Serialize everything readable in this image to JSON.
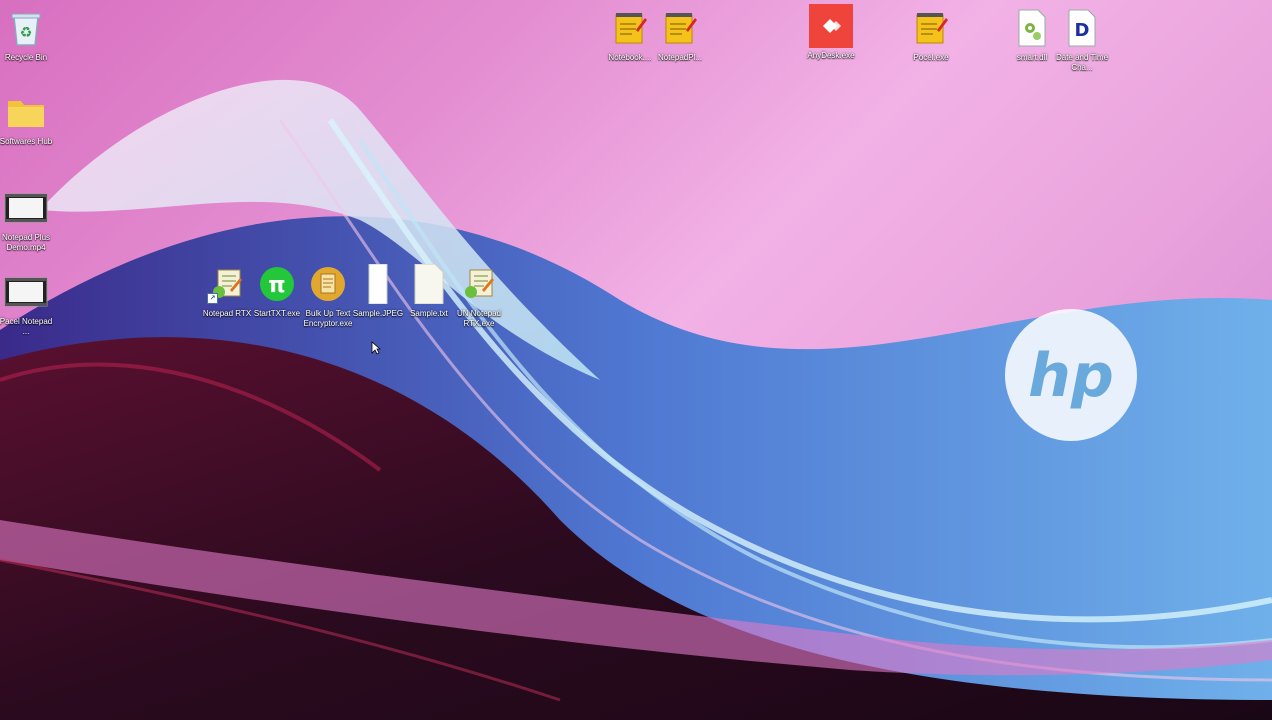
{
  "desktop": {
    "brand_logo": "hp",
    "icons_left": [
      {
        "label": "Recycle Bin",
        "icon": "recycle-bin-icon"
      },
      {
        "label": "Softwares Hub",
        "icon": "folder-icon"
      },
      {
        "label": "Notepad Plus Demo.mp4",
        "icon": "video-file-icon"
      },
      {
        "label": "Pacel Notepad ...",
        "icon": "video-file-icon"
      }
    ],
    "icons_top": [
      {
        "label": "Notebook....",
        "icon": "notepad-app-icon"
      },
      {
        "label": "NotepadPl...",
        "icon": "notepad-app-icon"
      },
      {
        "label": "AnyDesk.exe",
        "icon": "anydesk-icon"
      },
      {
        "label": "Pocel.exe",
        "icon": "notepad-app-icon"
      },
      {
        "label": "smart.dll",
        "icon": "dll-gear-icon"
      },
      {
        "label": "Date and Time Cha...",
        "icon": "document-d-icon"
      }
    ],
    "icons_middle": [
      {
        "label": "Notepad RTX",
        "icon": "notepad-rtx-icon"
      },
      {
        "label": "StartTXT.exe",
        "icon": "pi-icon"
      },
      {
        "label": "Bulk Up Text Encryptor.exe",
        "icon": "encryptor-icon"
      },
      {
        "label": "Sample.JPEG",
        "icon": "blank-file-icon"
      },
      {
        "label": "Sample.txt",
        "icon": "text-file-icon"
      },
      {
        "label": "UN Notepad RTX.exe",
        "icon": "notepad-rtx-icon"
      }
    ],
    "colors": {
      "anydesk": "#ef443b",
      "pi_green": "#22c73a",
      "encryptor_gold": "#e2a72e",
      "notepad_yellow": "#f4c21a"
    }
  }
}
